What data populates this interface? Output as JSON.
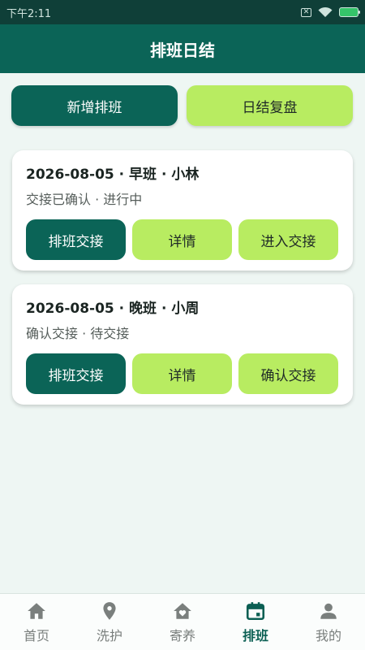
{
  "status_bar": {
    "time": "下午2:11",
    "sim_icon": "close-box-icon",
    "wifi_icon": "wifi-icon",
    "battery_icon": "battery-charging-icon"
  },
  "app_bar": {
    "title": "排班日结"
  },
  "top_actions": {
    "add_shift": "新增排班",
    "daily_review": "日结复盘"
  },
  "cards": [
    {
      "title": "2026-08-05 · 早班 · 小林",
      "subtitle": "交接已确认 · 进行中",
      "btn_handover": "排班交接",
      "btn_detail": "详情",
      "btn_action": "进入交接"
    },
    {
      "title": "2026-08-05 · 晚班 · 小周",
      "subtitle": "确认交接 · 待交接",
      "btn_handover": "排班交接",
      "btn_detail": "详情",
      "btn_action": "确认交接"
    }
  ],
  "bottom_nav": [
    {
      "label": "首页",
      "icon": "home-icon"
    },
    {
      "label": "洗护",
      "icon": "location-pin-icon"
    },
    {
      "label": "寄养",
      "icon": "house-heart-icon"
    },
    {
      "label": "排班",
      "icon": "calendar-icon",
      "active": true
    },
    {
      "label": "我的",
      "icon": "person-icon"
    }
  ],
  "colors": {
    "primary": "#0b6457",
    "lime": "#b8ec61",
    "background": "#eef6f3"
  }
}
